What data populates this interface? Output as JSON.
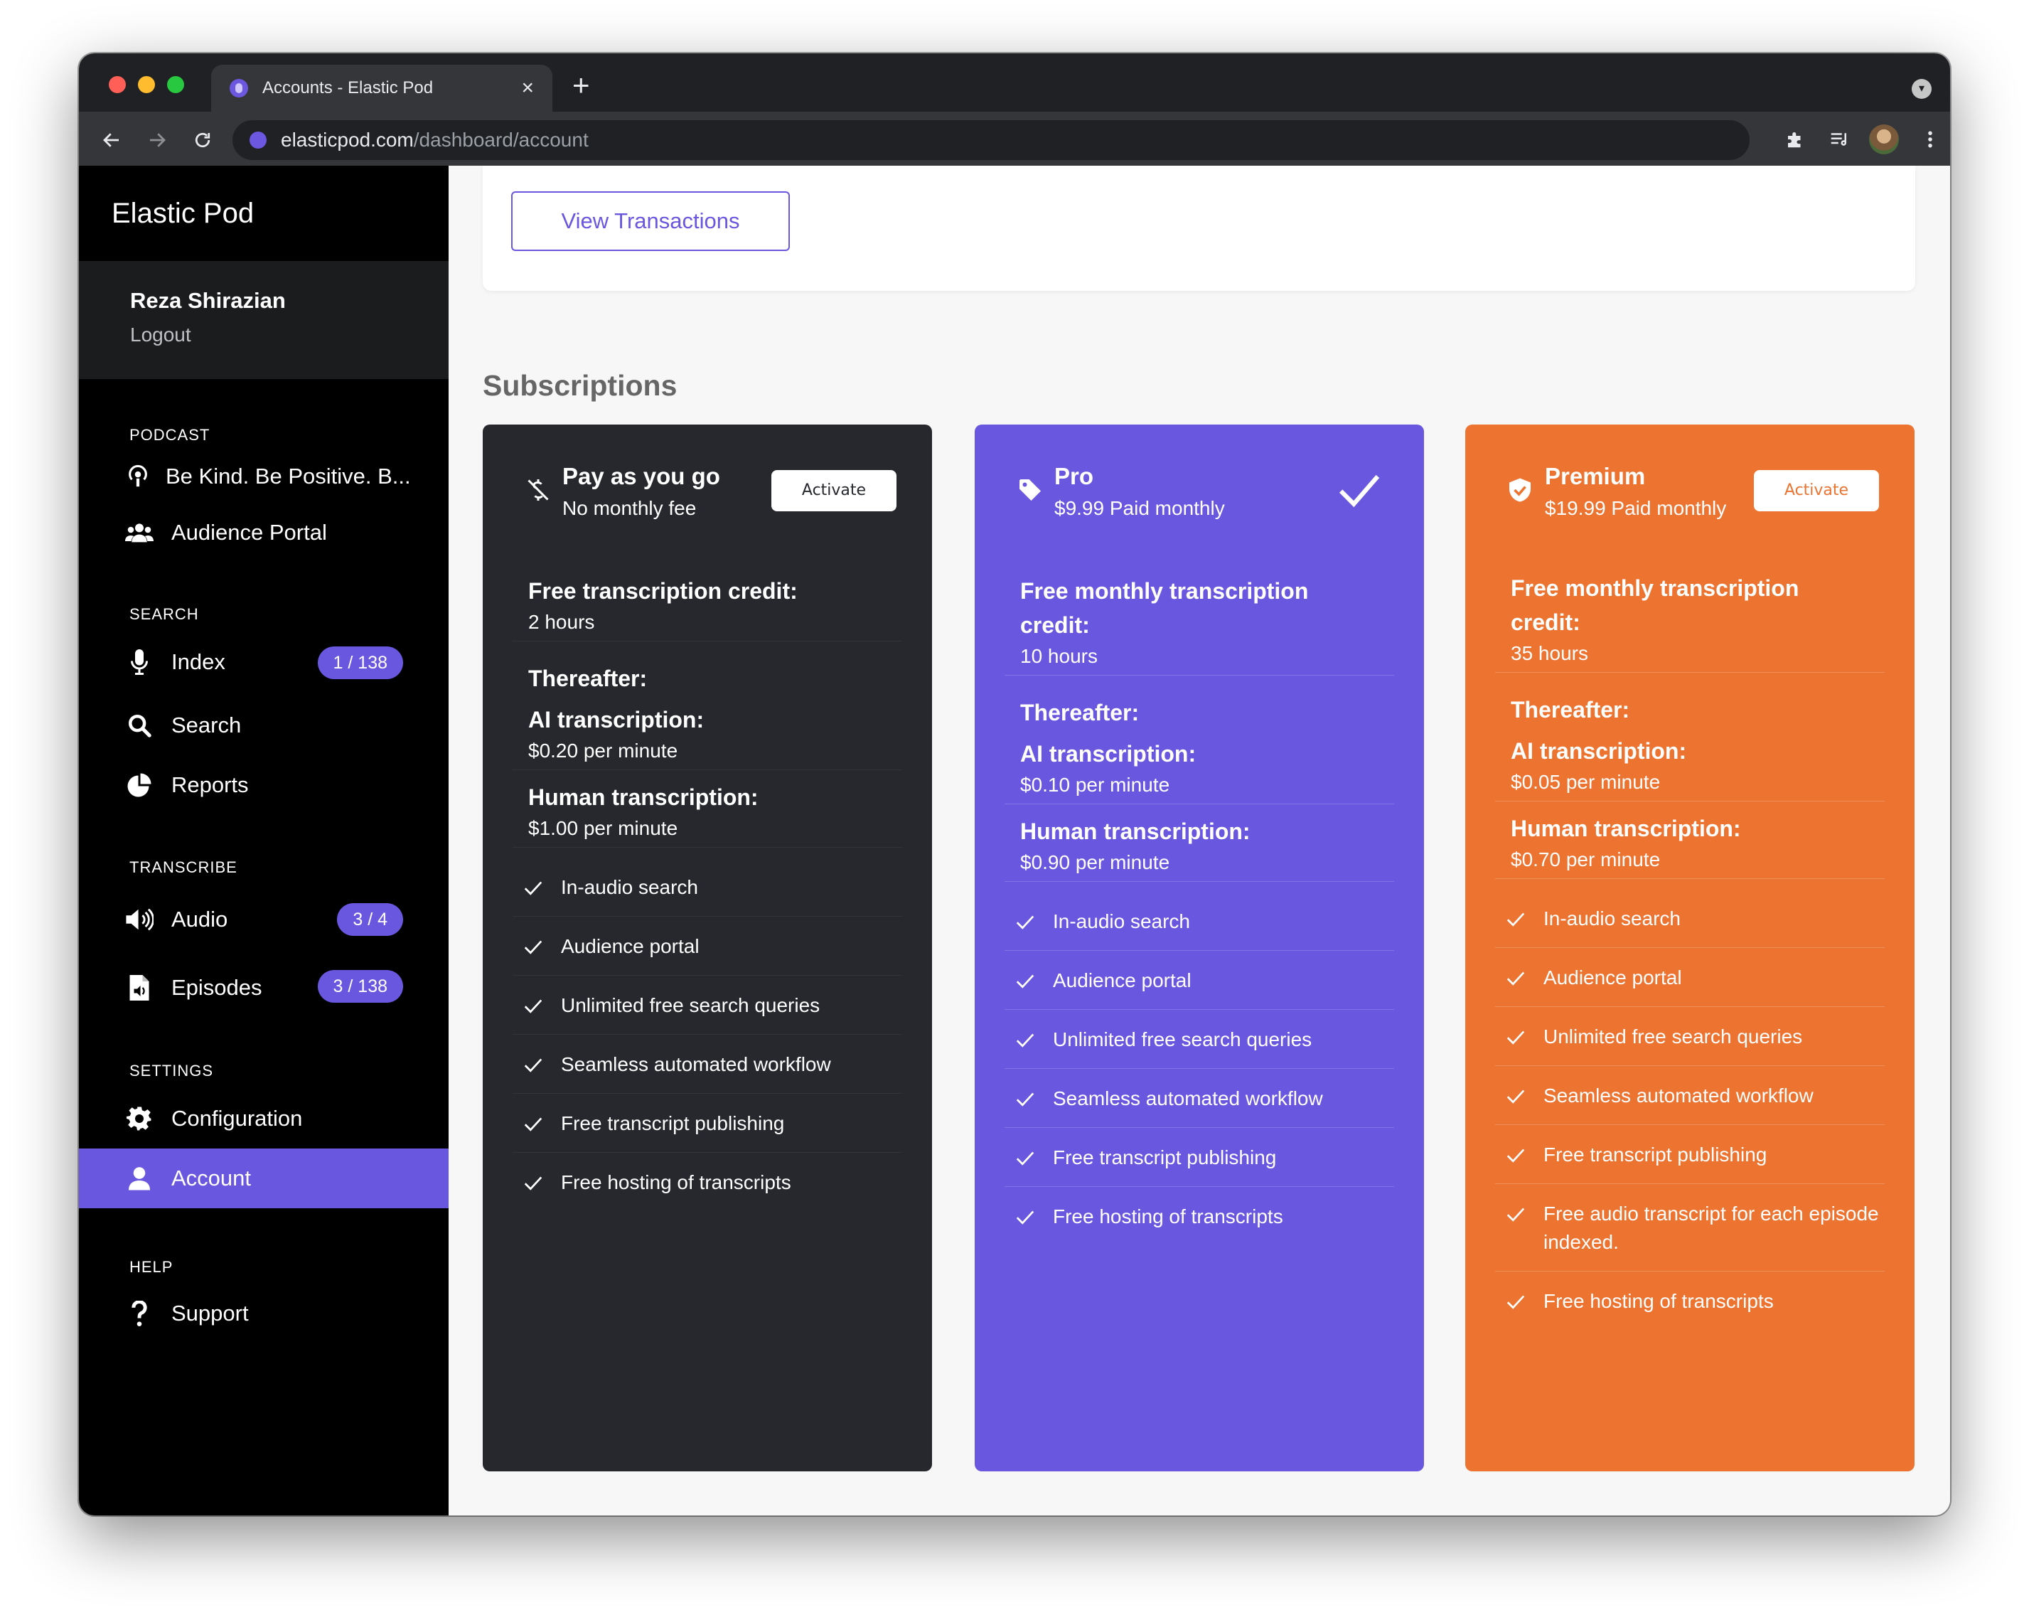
{
  "browser": {
    "tab_title": "Accounts - Elastic Pod",
    "tab_close": "×",
    "new_tab": "+",
    "url_host": "elasticpod.com",
    "url_path": "/dashboard/account"
  },
  "sidebar": {
    "brand": "Elastic Pod",
    "user_name": "Reza Shirazian",
    "logout": "Logout",
    "sections": {
      "podcast": "PODCAST",
      "search": "SEARCH",
      "transcribe": "TRANSCRIBE",
      "settings": "SETTINGS",
      "help": "HELP"
    },
    "items": {
      "podcast_name": "Be Kind. Be Positive. B...",
      "audience_portal": "Audience Portal",
      "index": "Index",
      "index_badge": "1 / 138",
      "search": "Search",
      "reports": "Reports",
      "audio": "Audio",
      "audio_badge": "3 / 4",
      "episodes": "Episodes",
      "episodes_badge": "3 / 138",
      "configuration": "Configuration",
      "account": "Account",
      "support": "Support"
    }
  },
  "main": {
    "view_transactions": "View Transactions",
    "subscriptions_title": "Subscriptions",
    "plans": [
      {
        "name": "Pay as you go",
        "subtitle": "No monthly fee",
        "action": "Activate",
        "credit_label": "Free transcription credit:",
        "credit_value": "2 hours",
        "thereafter": "Thereafter:",
        "ai_label": "AI transcription:",
        "ai_value": "$0.20 per minute",
        "human_label": "Human transcription:",
        "human_value": "$1.00 per minute",
        "features": [
          "In-audio search",
          "Audience portal",
          "Unlimited free search queries",
          "Seamless automated workflow",
          "Free transcript publishing",
          "Free hosting of transcripts"
        ]
      },
      {
        "name": "Pro",
        "subtitle": "$9.99 Paid monthly",
        "credit_label": "Free monthly transcription credit:",
        "credit_value": "10 hours",
        "thereafter": "Thereafter:",
        "ai_label": "AI transcription:",
        "ai_value": "$0.10 per minute",
        "human_label": "Human transcription:",
        "human_value": "$0.90 per minute",
        "features": [
          "In-audio search",
          "Audience portal",
          "Unlimited free search queries",
          "Seamless automated workflow",
          "Free transcript publishing",
          "Free hosting of transcripts"
        ]
      },
      {
        "name": "Premium",
        "subtitle": "$19.99 Paid monthly",
        "action": "Activate",
        "credit_label": "Free monthly transcription credit:",
        "credit_value": "35 hours",
        "thereafter": "Thereafter:",
        "ai_label": "AI transcription:",
        "ai_value": "$0.05 per minute",
        "human_label": "Human transcription:",
        "human_value": "$0.70 per minute",
        "features": [
          "In-audio search",
          "Audience portal",
          "Unlimited free search queries",
          "Seamless automated workflow",
          "Free transcript publishing",
          "Free audio transcript for each episode indexed.",
          "Free hosting of transcripts"
        ]
      }
    ]
  },
  "colors": {
    "accent": "#6a57e0",
    "dark_plan": "#26282d",
    "orange_plan": "#ec7330",
    "sidebar_bg": "#000000"
  }
}
